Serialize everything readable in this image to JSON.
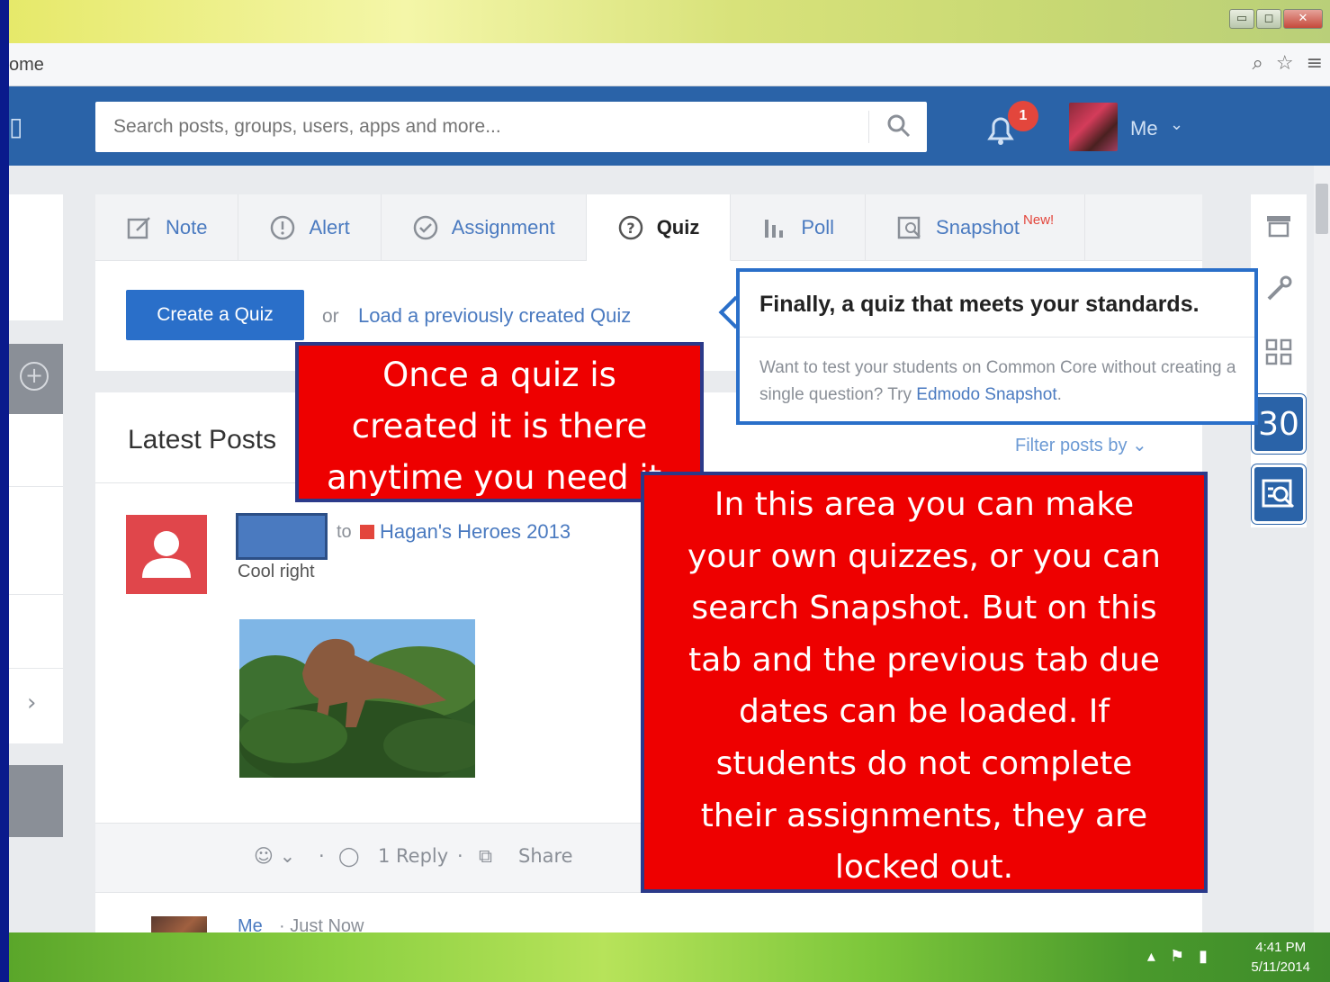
{
  "browser": {
    "address_fragment": "ome",
    "window_buttons": {
      "minimize": "▭",
      "maximize": "◻",
      "close": "✕"
    }
  },
  "topnav": {
    "search_placeholder": "Search posts, groups, users, apps and more...",
    "notification_count": "1",
    "user_label": "Me"
  },
  "composer": {
    "tabs": [
      {
        "label": "Note",
        "icon": "note-icon"
      },
      {
        "label": "Alert",
        "icon": "alert-icon"
      },
      {
        "label": "Assignment",
        "icon": "assignment-icon"
      },
      {
        "label": "Quiz",
        "icon": "quiz-icon",
        "active": true
      },
      {
        "label": "Poll",
        "icon": "poll-icon"
      },
      {
        "label": "Snapshot",
        "icon": "snapshot-icon",
        "badge": "New!"
      }
    ],
    "create_button": "Create a Quiz",
    "or_text": "or",
    "load_link": "Load a previously created Quiz"
  },
  "tooltip": {
    "title": "Finally, a quiz that meets your standards.",
    "body_pre": "Want to test your students on Common Core without creating a single question? Try ",
    "body_link": "Edmodo Snapshot",
    "body_post": "."
  },
  "posts": {
    "heading": "Latest Posts",
    "filter_label": "Filter posts by",
    "post": {
      "to_text": "to",
      "group": "Hagan's Heroes 2013",
      "text": "Cool right",
      "actions": {
        "reply": "1 Reply",
        "share": "Share"
      }
    },
    "next_post": {
      "author": "Me",
      "time": "· Just Now"
    }
  },
  "rail": {
    "calendar_day": "30"
  },
  "callouts": {
    "first": [
      "Once a quiz is",
      "created it is there",
      "anytime you need it."
    ],
    "second": [
      "In this area you can make",
      "your own quizzes, or you can",
      "search Snapshot. But on this",
      "tab and the previous tab due",
      "dates can be loaded. If",
      "students do not complete",
      "their assignments, they are",
      "locked out."
    ]
  },
  "taskbar": {
    "time": "4:41 PM",
    "date": "5/11/2014"
  },
  "colors": {
    "brand_blue": "#2a63a8",
    "accent_red": "#e3463c",
    "callout_red": "#ee0000"
  }
}
